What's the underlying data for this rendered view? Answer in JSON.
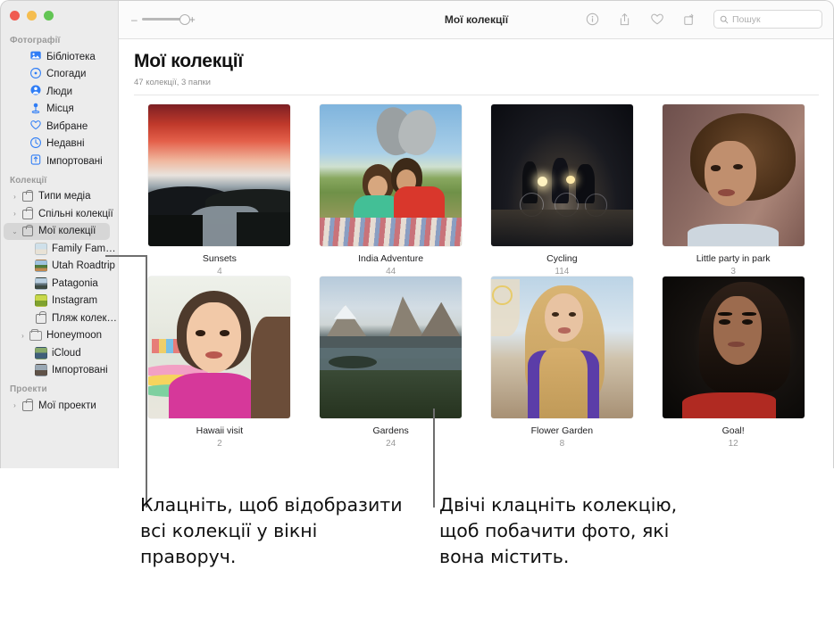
{
  "window": {
    "traffic_lights": [
      "close",
      "minimize",
      "zoom"
    ],
    "colors": {
      "close": "#f05b51",
      "minimize": "#f5bd4f",
      "zoom": "#62c554",
      "accent": "#007aff"
    }
  },
  "toolbar": {
    "title": "Мої колекції",
    "zoom_out_label": "–",
    "zoom_in_label": "+",
    "icons": [
      "info-icon",
      "share-icon",
      "heart-icon",
      "rotate-icon"
    ],
    "search": {
      "placeholder": "Пошук",
      "value": ""
    }
  },
  "sidebar": {
    "sections": [
      {
        "header": "Фотографії",
        "items": [
          {
            "label": "Бібліотека",
            "icon": "library-icon",
            "twisty": "",
            "indent": 1
          },
          {
            "label": "Спогади",
            "icon": "memories-icon",
            "twisty": "",
            "indent": 1
          },
          {
            "label": "Люди",
            "icon": "people-icon",
            "twisty": "",
            "indent": 1
          },
          {
            "label": "Місця",
            "icon": "places-icon",
            "twisty": "",
            "indent": 1
          },
          {
            "label": "Вибране",
            "icon": "heart-icon",
            "twisty": "",
            "indent": 1
          },
          {
            "label": "Недавні",
            "icon": "recents-icon",
            "twisty": "",
            "indent": 1
          },
          {
            "label": "Імпортовані",
            "icon": "imported-icon",
            "twisty": "",
            "indent": 1
          }
        ]
      },
      {
        "header": "Колекції",
        "items": [
          {
            "label": "Типи медіа",
            "icon": "bag-icon",
            "twisty": "collapsed",
            "indent": 0
          },
          {
            "label": "Спільні колекції",
            "icon": "bag-shared-icon",
            "twisty": "collapsed",
            "indent": 0
          },
          {
            "label": "Мої колекції",
            "icon": "bag-icon",
            "twisty": "expanded",
            "indent": 0,
            "selected": true
          },
          {
            "label": "Family Family...",
            "icon": "album-thumb-family",
            "twisty": "",
            "indent": 2
          },
          {
            "label": "Utah Roadtrip",
            "icon": "album-thumb-utah",
            "twisty": "",
            "indent": 2
          },
          {
            "label": "Patagonia",
            "icon": "album-thumb-patagonia",
            "twisty": "",
            "indent": 2
          },
          {
            "label": "Instagram",
            "icon": "album-thumb-instagram",
            "twisty": "",
            "indent": 2
          },
          {
            "label": "Пляж колекція",
            "icon": "bag-icon",
            "twisty": "",
            "indent": 2
          },
          {
            "label": "Honeymoon",
            "icon": "folder-icon",
            "twisty": "collapsed",
            "indent": 1
          },
          {
            "label": "iCloud",
            "icon": "album-thumb-icloud",
            "twisty": "",
            "indent": 2
          },
          {
            "label": "Імпортовані",
            "icon": "album-thumb-imported",
            "twisty": "",
            "indent": 2
          }
        ]
      },
      {
        "header": "Проекти",
        "items": [
          {
            "label": "Мої проекти",
            "icon": "bag-icon",
            "twisty": "collapsed",
            "indent": 0
          }
        ]
      }
    ]
  },
  "main": {
    "title": "Мої колекції",
    "subtitle": "47 колекції, 3 папки",
    "albums": [
      {
        "name": "Sunsets",
        "count": "4",
        "art": "sunset"
      },
      {
        "name": "India Adventure",
        "count": "44",
        "art": "kids"
      },
      {
        "name": "Cycling",
        "count": "114",
        "art": "night-cyclists"
      },
      {
        "name": "Little party in park",
        "count": "3",
        "art": "curly-portrait"
      },
      {
        "name": "Hawaii visit",
        "count": "2",
        "art": "girl-pink"
      },
      {
        "name": "Gardens",
        "count": "24",
        "art": "mountains"
      },
      {
        "name": "Flower Garden",
        "count": "8",
        "art": "blonde-purple"
      },
      {
        "name": "Goal!",
        "count": "12",
        "art": "dark-portrait"
      }
    ]
  },
  "callouts": [
    {
      "id": "left-callout",
      "text": "Клацніть, щоб відобразити всі колекції у вікні праворуч."
    },
    {
      "id": "right-callout",
      "text": "Двічі клацніть колекцію, щоб побачити фото, які вона містить."
    }
  ]
}
